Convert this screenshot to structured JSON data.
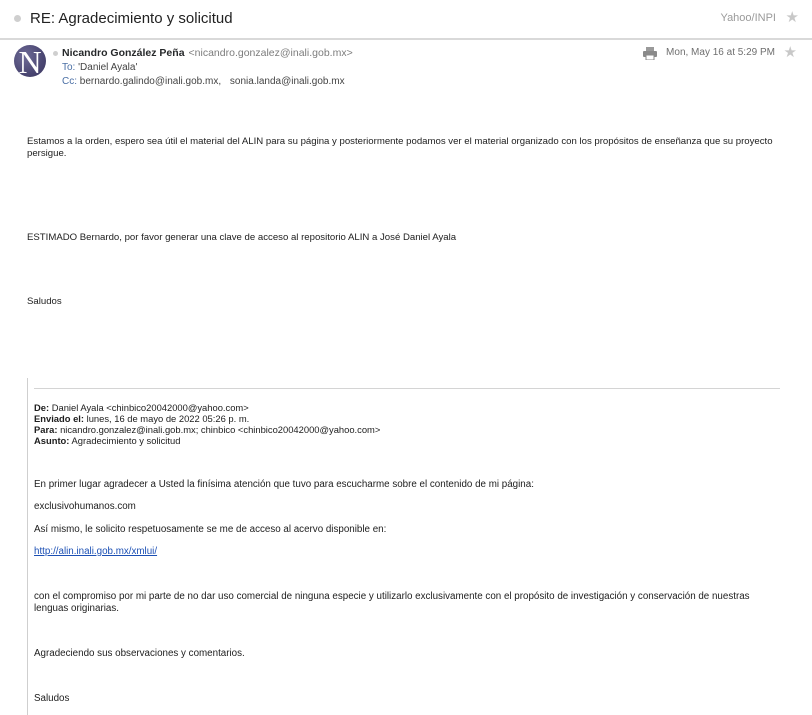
{
  "subject": {
    "title": "RE: Agradecimiento y solicitud",
    "folder": "Yahoo/INPI"
  },
  "header": {
    "avatar_letter": "N",
    "sender_name": "Nicandro González Peña",
    "sender_email": "<nicandro.gonzalez@inali.gob.mx>",
    "to_label": "To:",
    "to_value": "'Daniel Ayala'",
    "cc_label": "Cc:",
    "cc_values": [
      "bernardo.galindo@inali.gob.mx,",
      "sonia.landa@inali.gob.mx"
    ],
    "date": "Mon, May 16 at 5:29 PM"
  },
  "body": {
    "p1": "Estamos a la orden, espero sea útil el material del ALIN para su página y posteriormente podamos ver el material organizado con los propósitos de enseñanza que su proyecto persigue.",
    "p2": "ESTIMADO Bernardo, por favor generar una clave de acceso al repositorio ALIN a José Daniel Ayala",
    "p3": "Saludos"
  },
  "quoted": {
    "de_label": "De:",
    "de_value": "Daniel Ayala <chinbico20042000@yahoo.com>",
    "enviado_label": "Enviado el:",
    "enviado_value": "lunes, 16 de mayo de 2022 05:26 p. m.",
    "para_label": "Para:",
    "para_value": "nicandro.gonzalez@inali.gob.mx; chinbico <chinbico20042000@yahoo.com>",
    "asunto_label": "Asunto:",
    "asunto_value": "Agradecimiento y solicitud",
    "lines": [
      "En primer lugar agradecer a Usted la finísima atención que tuvo para escucharme sobre el contenido de mi página:",
      "exclusivohumanos.com",
      "Así mismo, le solicito respetuosamente se me de acceso al acervo disponible en:",
      "http://alin.inali.gob.mx/xmlui/",
      "con el compromiso por mi parte de no dar uso comercial de ninguna especie y utilizarlo exclusivamente con el propósito de investigación y conservación de nuestras lenguas originarias.",
      "Agradeciendo sus observaciones y comentarios.",
      "Saludos"
    ]
  },
  "icons": {
    "star": "star-icon",
    "print": "print-icon"
  }
}
